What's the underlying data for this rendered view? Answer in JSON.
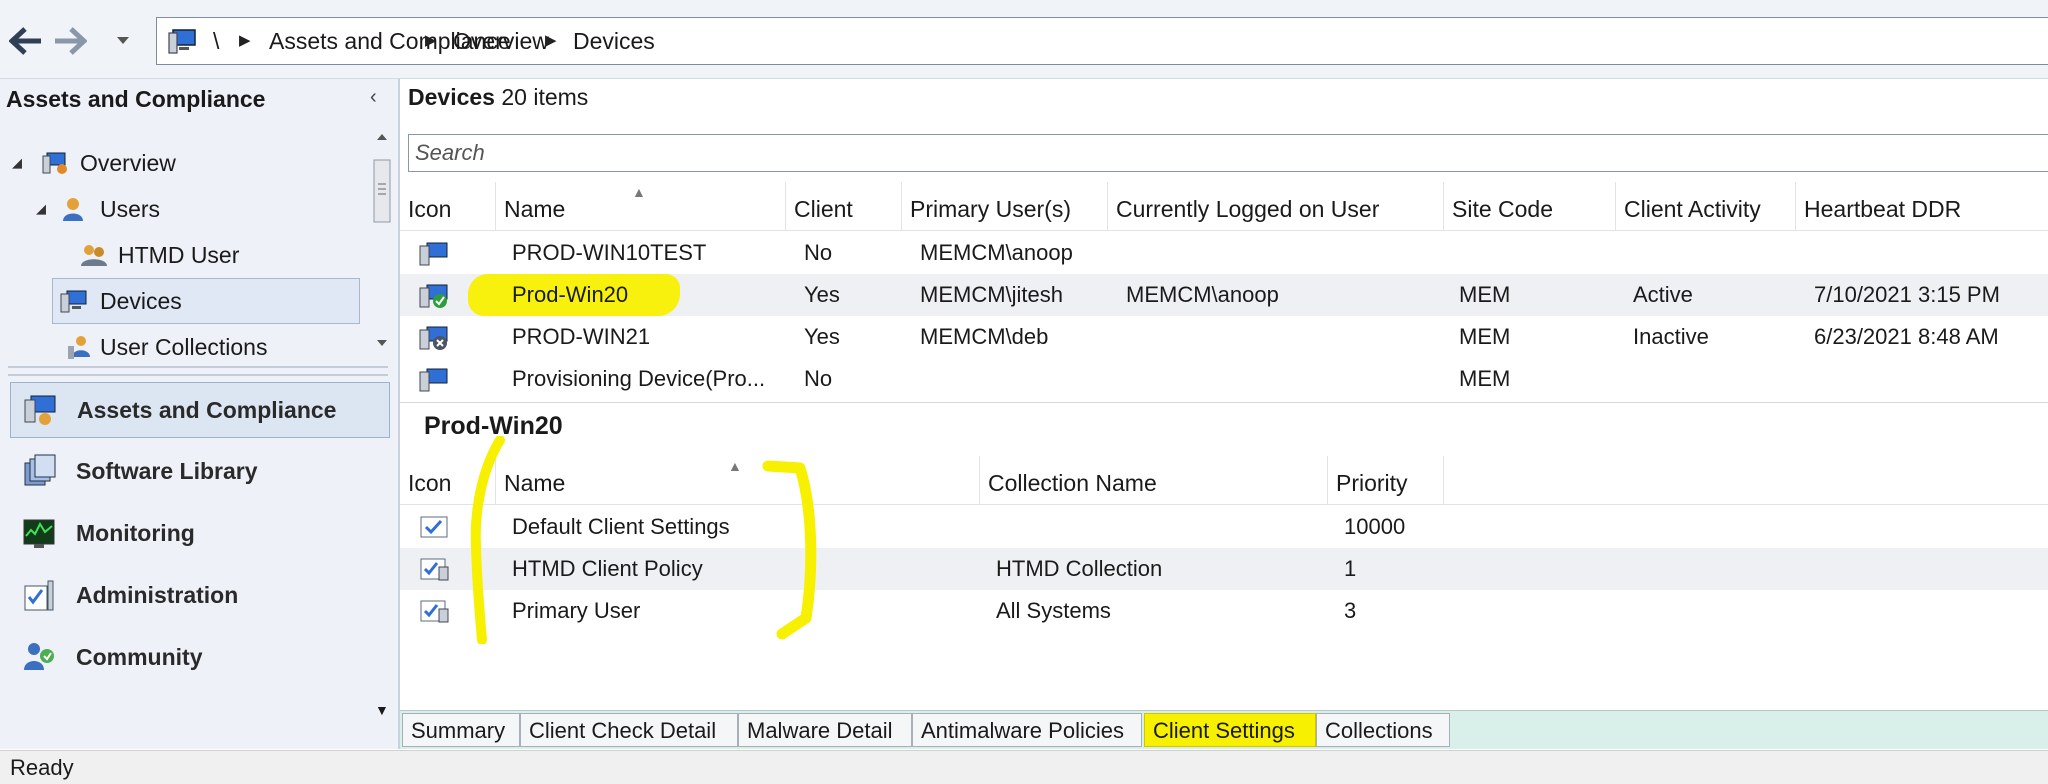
{
  "breadcrumb": {
    "root": "\\",
    "items": [
      "Assets and Compliance",
      "Overview",
      "Devices"
    ]
  },
  "left": {
    "title": "Assets and Compliance",
    "tree": [
      {
        "label": "Overview",
        "icon": "overview-icon"
      },
      {
        "label": "Users",
        "icon": "users-icon"
      },
      {
        "label": "HTMD User",
        "icon": "user-group-icon"
      },
      {
        "label": "Devices",
        "icon": "devices-icon",
        "selected": true
      },
      {
        "label": "User Collections",
        "icon": "user-collections-icon"
      }
    ],
    "workspaces": [
      {
        "label": "Assets and Compliance",
        "icon": "assets-compliance-icon",
        "selected": true
      },
      {
        "label": "Software Library",
        "icon": "software-library-icon"
      },
      {
        "label": "Monitoring",
        "icon": "monitoring-icon"
      },
      {
        "label": "Administration",
        "icon": "administration-icon"
      },
      {
        "label": "Community",
        "icon": "community-icon"
      }
    ]
  },
  "main": {
    "title_bold": "Devices",
    "title_count": "20 items",
    "search_placeholder": "Search",
    "columns": [
      "Icon",
      "Name",
      "Client",
      "Primary User(s)",
      "Currently Logged on User",
      "Site Code",
      "Client Activity",
      "Heartbeat DDR"
    ],
    "rows": [
      {
        "name": "PROD-WIN10TEST",
        "client": "No",
        "primary_user": "MEMCM\\anoop",
        "logged_on": "",
        "site": "",
        "activity": "",
        "heartbeat": ""
      },
      {
        "name": "Prod-Win20",
        "client": "Yes",
        "primary_user": "MEMCM\\jitesh",
        "logged_on": "MEMCM\\anoop",
        "site": "MEM",
        "activity": "Active",
        "heartbeat": "7/10/2021 3:15 PM"
      },
      {
        "name": "PROD-WIN21",
        "client": "Yes",
        "primary_user": "MEMCM\\deb",
        "logged_on": "",
        "site": "MEM",
        "activity": "Inactive",
        "heartbeat": "6/23/2021 8:48 AM"
      },
      {
        "name": "Provisioning Device(Pro...",
        "client": "No",
        "primary_user": "",
        "logged_on": "",
        "site": "MEM",
        "activity": "",
        "heartbeat": ""
      }
    ]
  },
  "detail": {
    "title": "Prod-Win20",
    "columns": [
      "Icon",
      "Name",
      "Collection Name",
      "Priority"
    ],
    "rows": [
      {
        "name": "Default Client Settings",
        "collection": "",
        "priority": "10000"
      },
      {
        "name": "HTMD Client Policy",
        "collection": "HTMD Collection",
        "priority": "1"
      },
      {
        "name": "Primary User",
        "collection": "All Systems",
        "priority": "3"
      }
    ]
  },
  "tabs": [
    {
      "label": "Summary"
    },
    {
      "label": "Client Check Detail"
    },
    {
      "label": "Malware Detail"
    },
    {
      "label": "Antimalware Policies"
    },
    {
      "label": "Client Settings",
      "active": true
    },
    {
      "label": "Collections"
    }
  ],
  "status": "Ready",
  "colors": {
    "highlight": "#f7f000",
    "nav_bg": "#eef2f8",
    "tab_strip": "#d9efe9"
  }
}
